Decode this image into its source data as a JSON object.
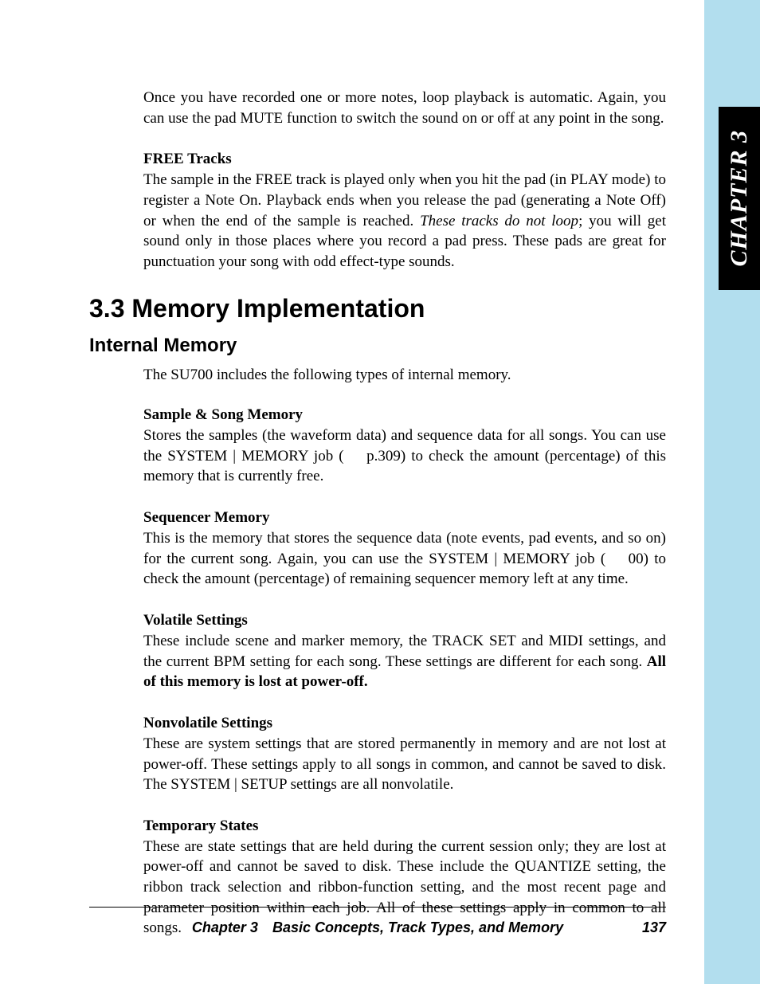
{
  "tab": {
    "label": "CHAPTER  3"
  },
  "intro": {
    "p1": "Once you have recorded one or more notes, loop playback is automatic. Again, you can use the pad MUTE function to switch the sound on or off at any point in the song."
  },
  "free_tracks": {
    "heading": "FREE Tracks",
    "p_a": "The sample in the FREE track is played only when you hit the pad (in PLAY mode) to register a Note On. Playback ends when you release the pad (generating a Note Off) or when the end of the sample is reached. ",
    "p_italic": "These tracks do not loop",
    "p_b": "; you will get sound only in those places where you record a pad press. These pads are great for punctuation your song with odd effect-type sounds."
  },
  "section": {
    "heading": "3.3 Memory Implementation",
    "subheading": "Internal Memory",
    "intro": "The SU700 includes the following types of internal memory."
  },
  "sample_song": {
    "heading": "Sample & Song Memory",
    "p": "Stores the samples (the waveform data) and sequence data for all songs. You can use the SYSTEM | MEMORY job (   p.309) to check the amount (percentage) of this memory that is currently free."
  },
  "sequencer": {
    "heading": "Sequencer Memory",
    "p": "This is the memory that stores the sequence data (note events, pad events, and so on) for the current song. Again, you can use the SYSTEM | MEMORY job (   00) to check the amount (percentage) of remaining sequencer memory left at any time."
  },
  "volatile": {
    "heading": "Volatile Settings",
    "p_a": "These include scene and marker memory, the TRACK SET and MIDI settings, and the current BPM setting for each song. These settings are different for each song. ",
    "p_bold": "All of this memory is lost at power-off."
  },
  "nonvolatile": {
    "heading": "Nonvolatile Settings",
    "p": "These are system settings that are stored permanently in memory and are not lost at power-off. These settings apply to all songs in common, and cannot be saved to disk. The SYSTEM | SETUP settings are all nonvolatile."
  },
  "temporary": {
    "heading": "Temporary States",
    "p": "These are state settings that are held during the current session only; they are lost at power-off and cannot be saved to disk. These include the QUANTIZE setting, the ribbon track selection and ribbon-function setting, and the most recent page and parameter position within each job. All of these settings apply in common to all songs."
  },
  "footer": {
    "title": "Chapter 3 Basic Concepts, Track Types, and Memory",
    "page": "137"
  }
}
